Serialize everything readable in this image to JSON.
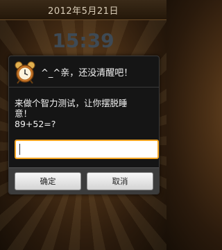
{
  "status": {
    "date": "2012年5月21日",
    "time": "15:39"
  },
  "dialog": {
    "icon": "alarm-clock-icon",
    "title": "^_^亲，还没清醒吧！",
    "message_line1": "来做个智力测试，让你摆脱睡",
    "message_line2": "意！",
    "question": "89+52=?",
    "answer_value": "",
    "ok_label": "确定",
    "cancel_label": "取消"
  },
  "colors": {
    "input_focus_border": "#f5a623",
    "dialog_background": "#151515",
    "button_bar": "#3c3c3c"
  }
}
